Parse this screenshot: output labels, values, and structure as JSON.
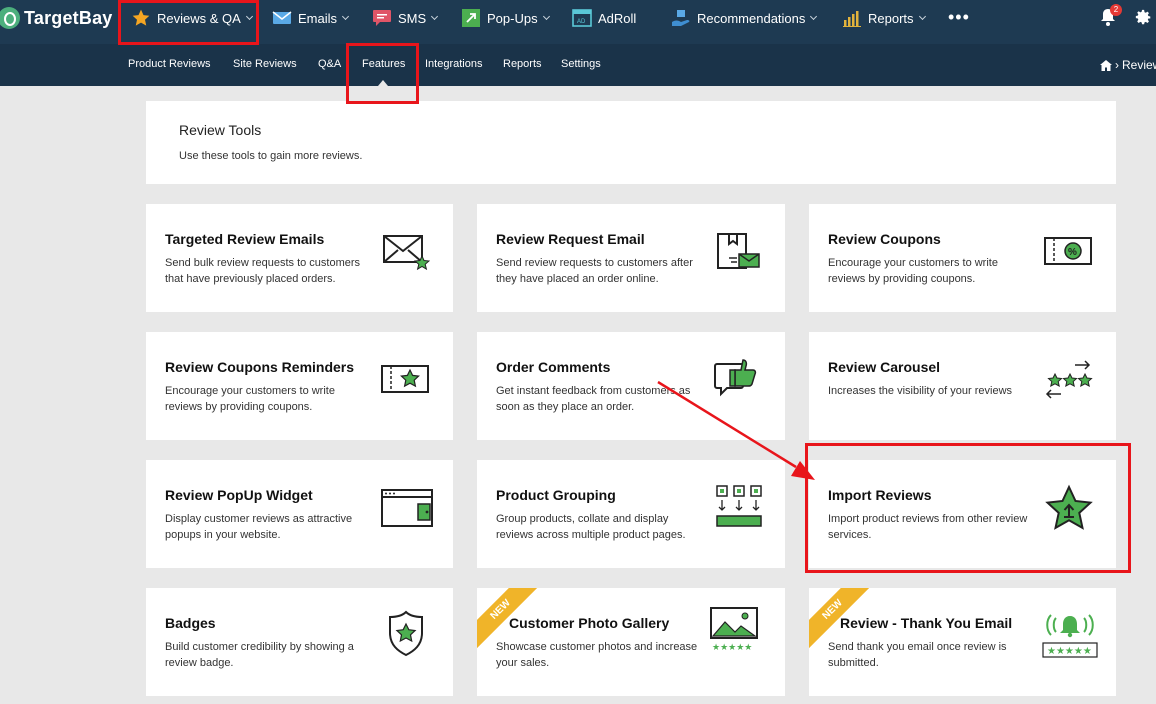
{
  "brand": {
    "name": "TargetBay"
  },
  "nav": {
    "items": [
      {
        "label": "Reviews & QA",
        "icon": "star-icon",
        "dropdown": true
      },
      {
        "label": "Emails",
        "icon": "envelope-icon",
        "dropdown": true
      },
      {
        "label": "SMS",
        "icon": "chat-icon",
        "dropdown": true
      },
      {
        "label": "Pop-Ups",
        "icon": "popup-icon",
        "dropdown": true
      },
      {
        "label": "AdRoll",
        "icon": "adroll-icon",
        "dropdown": false
      },
      {
        "label": "Recommendations",
        "icon": "hand-box-icon",
        "dropdown": true
      },
      {
        "label": "Reports",
        "icon": "bar-chart-icon",
        "dropdown": true
      }
    ],
    "more": "•••",
    "notifications_count": "2"
  },
  "subnav": {
    "items": [
      "Product Reviews",
      "Site Reviews",
      "Q&A",
      "Features",
      "Integrations",
      "Reports",
      "Settings"
    ],
    "active": "Features",
    "breadcrumb": "Review"
  },
  "header": {
    "title": "Review Tools",
    "subtitle": "Use these tools to gain more reviews."
  },
  "cards": [
    {
      "title": "Targeted Review Emails",
      "desc": "Send bulk review requests to customers that have previously placed orders.",
      "icon": "envelope-star-icon",
      "badge": ""
    },
    {
      "title": "Review Request Email",
      "desc": "Send review requests to customers after they have placed an order online.",
      "icon": "document-mail-icon",
      "badge": ""
    },
    {
      "title": "Review Coupons",
      "desc": "Encourage your customers to write reviews by providing coupons.",
      "icon": "percent-coupon-icon",
      "badge": ""
    },
    {
      "title": "Review Coupons Reminders",
      "desc": "Encourage your customers to write reviews by providing coupons.",
      "icon": "star-coupon-icon",
      "badge": ""
    },
    {
      "title": "Order Comments",
      "desc": "Get instant feedback from customers as soon as they place an order.",
      "icon": "thumbs-up-bubble-icon",
      "badge": ""
    },
    {
      "title": "Review Carousel",
      "desc": "Increases the visibility of your reviews",
      "icon": "star-carousel-icon",
      "badge": ""
    },
    {
      "title": "Review PopUp Widget",
      "desc": "Display customer reviews as attractive popups in your website.",
      "icon": "popup-window-icon",
      "badge": ""
    },
    {
      "title": "Product Grouping",
      "desc": "Group products, collate and display reviews across multiple product pages.",
      "icon": "product-group-icon",
      "badge": ""
    },
    {
      "title": "Import Reviews",
      "desc": "Import product reviews from other review services.",
      "icon": "star-upload-icon",
      "badge": ""
    },
    {
      "title": "Badges",
      "desc": "Build customer credibility by showing a review badge.",
      "icon": "shield-star-icon",
      "badge": ""
    },
    {
      "title": "Customer Photo Gallery",
      "desc": "Showcase customer photos and increase your sales.",
      "icon": "photo-rating-icon",
      "badge": "NEW"
    },
    {
      "title": "Review - Thank You Email",
      "desc": "Send thank you email once review is submitted.",
      "icon": "bell-rating-icon",
      "badge": "NEW"
    }
  ],
  "colors": {
    "nav_bg": "#1e3a52",
    "subnav_bg": "#1a3349",
    "page_bg": "#e8e8e8",
    "icon_green": "#4caf50",
    "badge_yellow": "#f0b429",
    "highlight_red": "#e8151b"
  }
}
